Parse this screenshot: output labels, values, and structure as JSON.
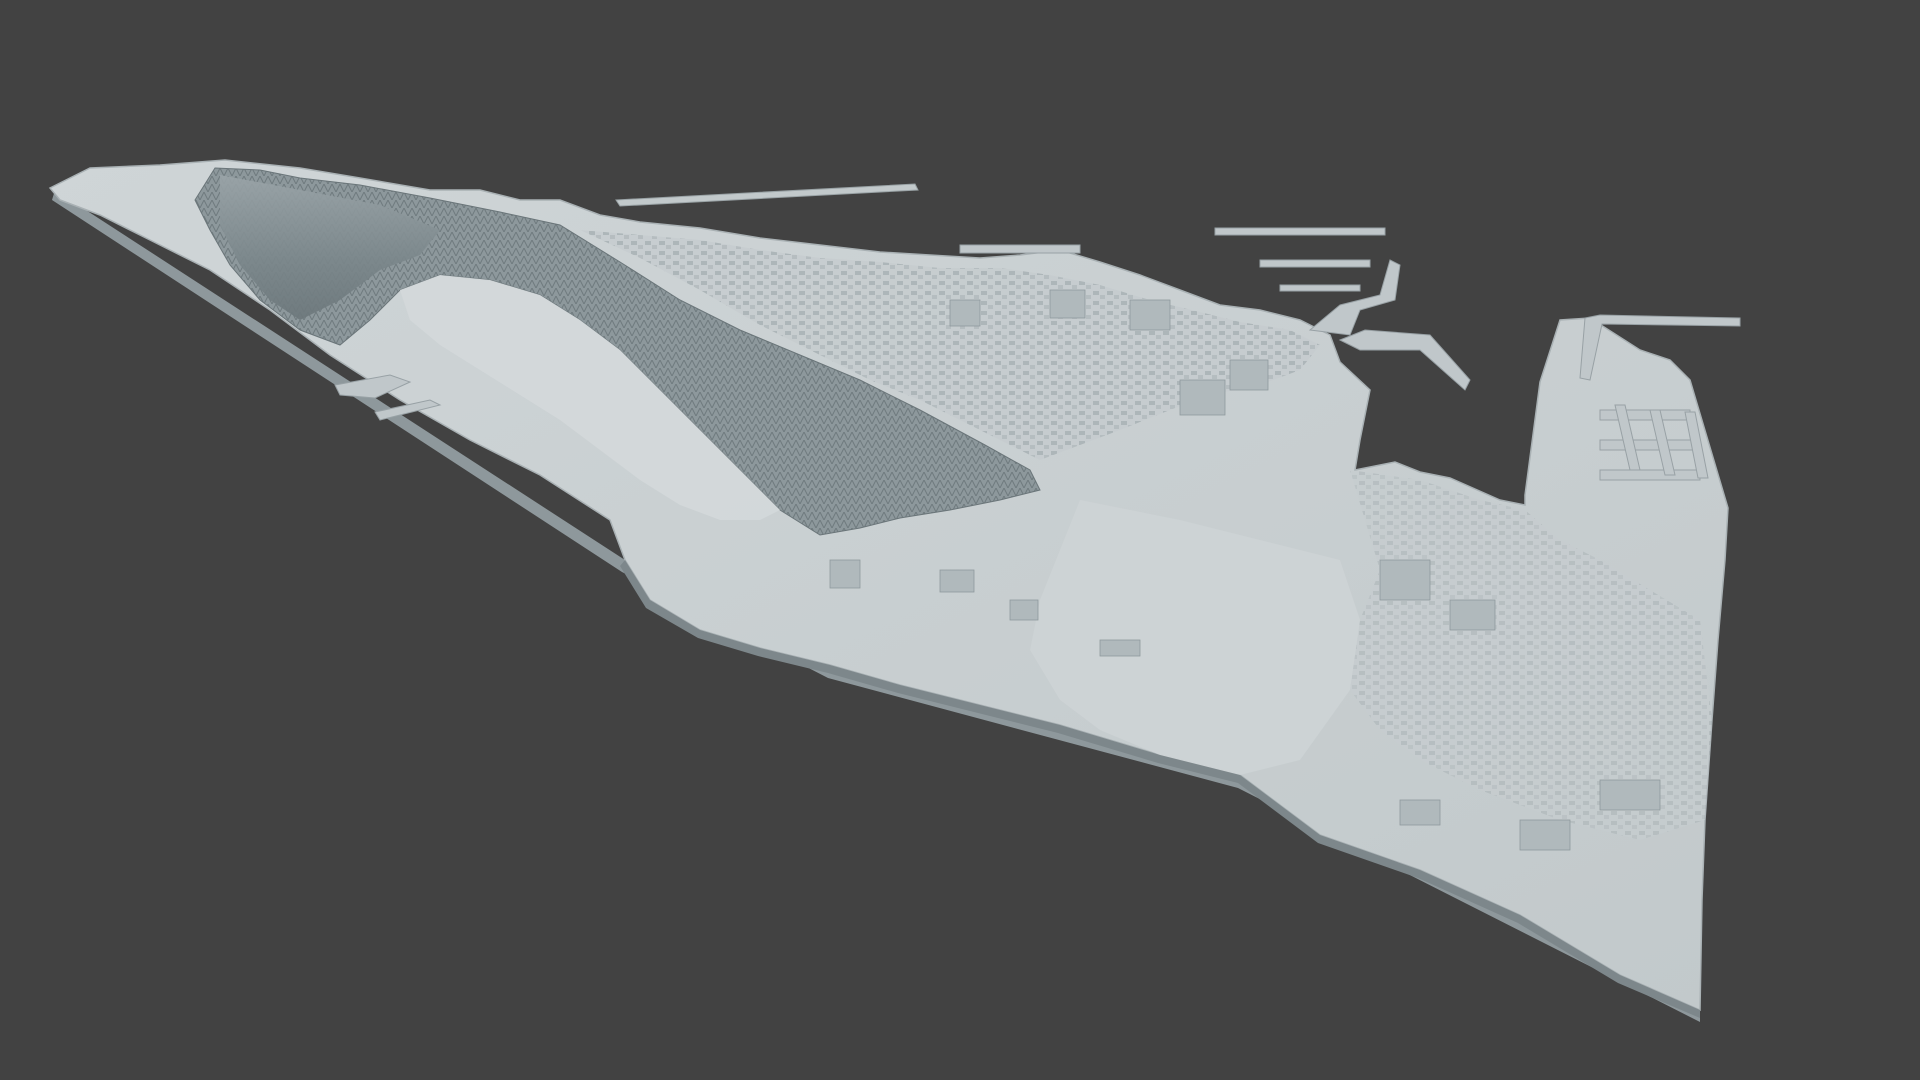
{
  "scene": {
    "background_color": "#424242",
    "model_color": "#c9cfd1",
    "model_shadow_color": "#7f8a8e",
    "subject": "3d-terrain-model"
  }
}
